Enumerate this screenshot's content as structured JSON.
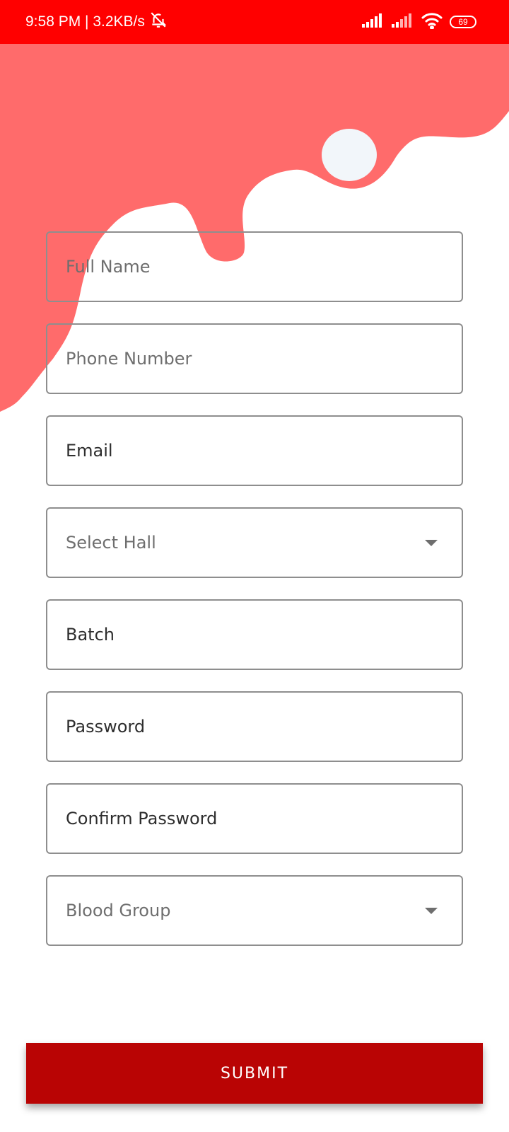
{
  "status_bar": {
    "time_speed": "9:58 PM | 3.2KB/s",
    "battery_level": "69",
    "icons": [
      "bell-muted-icon",
      "signal-icon",
      "signal-weak-icon",
      "wifi-icon",
      "battery-icon"
    ]
  },
  "colors": {
    "status_bar": "#ff0000",
    "splash": "#ff6b6b",
    "submit_button": "#b90404",
    "field_border": "#8e8e8e"
  },
  "form": {
    "full_name_placeholder": "Full Name",
    "phone_placeholder": "Phone Number",
    "email_placeholder": "Email",
    "hall_select": "Select Hall",
    "batch_placeholder": "Batch",
    "password_placeholder": "Password",
    "confirm_password_placeholder": "Confirm Password",
    "blood_group_select": "Blood Group"
  },
  "submit_label": "SUBMIT"
}
